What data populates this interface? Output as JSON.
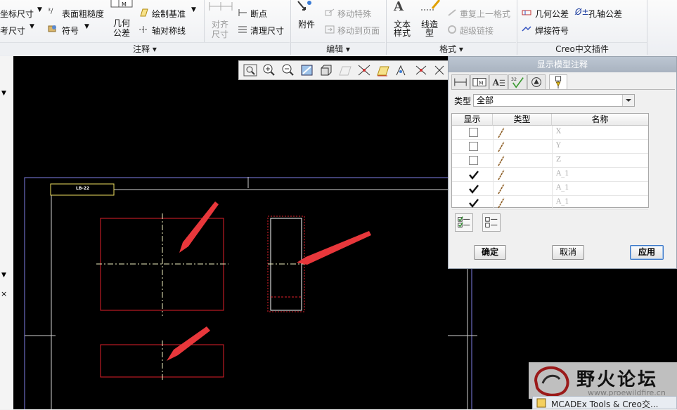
{
  "ribbon": {
    "annotate": {
      "coord_dim": "坐标尺寸",
      "surface_roughness": "表面粗糙度",
      "ref_dim": "考尺寸",
      "symbol": "符号",
      "geo_tol_line1": "几何",
      "geo_tol_line2": "公差",
      "draw_datum": "绘制基准",
      "axis_symmetry": "轴对称线",
      "align_dim_line1": "对齐",
      "align_dim_line2": "尺寸",
      "break": "断点",
      "cleanup_dim": "清理尺寸",
      "group_label": "注释"
    },
    "edit": {
      "attach": "附件",
      "move_special": "移动特殊",
      "move_to_page": "移动到页面",
      "group_label": "编辑"
    },
    "format": {
      "text_style_line1": "文本",
      "text_style_line2": "样式",
      "line_style_line1": "线造",
      "line_style_line2": "型",
      "repeat_last": "重复上一格式",
      "hyperlink": "超级链接",
      "group_label": "格式"
    },
    "plugin": {
      "geo_tol": "几何公差",
      "hole_shaft_tol": "孔轴公差",
      "weld_symbol": "焊接符号",
      "group_label": "Creo中文插件"
    }
  },
  "drawing": {
    "title_tag": "LB-22"
  },
  "dialog": {
    "title": "显示模型注释",
    "type_label": "类型",
    "type_value": "全部",
    "columns": {
      "show": "显示",
      "type": "类型",
      "name": "名称"
    },
    "rows": [
      {
        "name": "X",
        "checked": false
      },
      {
        "name": "Y",
        "checked": false
      },
      {
        "name": "Z",
        "checked": false
      },
      {
        "name": "A_1",
        "checked": true
      },
      {
        "name": "A_1",
        "checked": true
      },
      {
        "name": "A_1",
        "checked": true
      }
    ],
    "ok": "确定",
    "cancel": "取消",
    "apply": "应用"
  },
  "watermark": {
    "title": "野火论坛",
    "url": "www.proewildfire.cn"
  },
  "taskbar": {
    "label": "MCADEx Tools & Creo交..."
  },
  "colors": {
    "canvas": "#000000",
    "drawing_red": "#e0202a",
    "arrow_red": "#e8373b",
    "highlight": "#3c78c8"
  }
}
